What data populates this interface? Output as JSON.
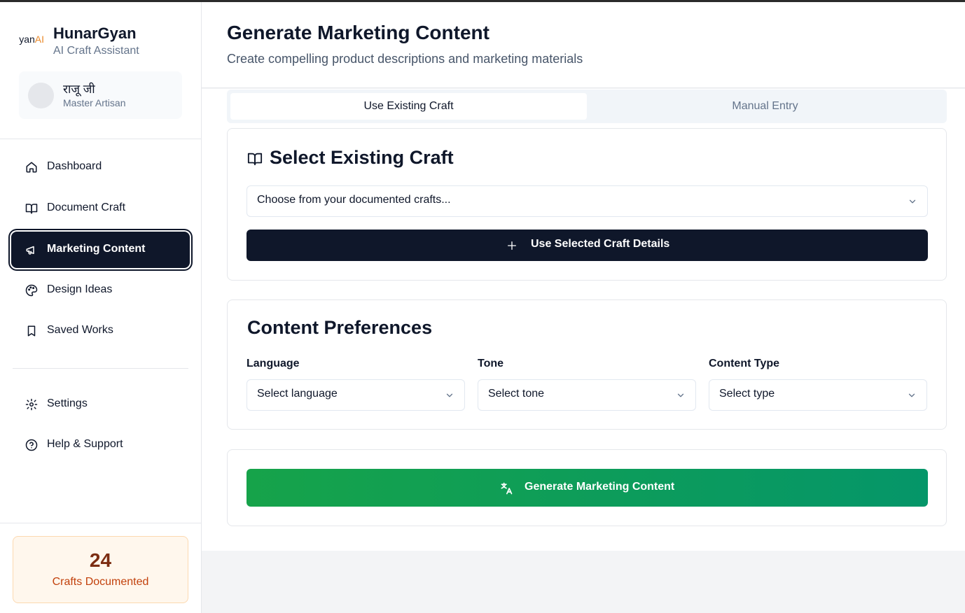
{
  "brand": {
    "logo_text": "yanAI",
    "logo_main": "yan",
    "logo_ai": "AI",
    "title": "HunarGyan",
    "subtitle": "AI Craft Assistant"
  },
  "user": {
    "name": "राजू जी",
    "role": "Master Artisan"
  },
  "nav": {
    "items": [
      {
        "label": "Dashboard",
        "icon": "home-icon",
        "active": false
      },
      {
        "label": "Document Craft",
        "icon": "book-open-icon",
        "active": false
      },
      {
        "label": "Marketing Content",
        "icon": "megaphone-icon",
        "active": true
      },
      {
        "label": "Design Ideas",
        "icon": "palette-icon",
        "active": false
      },
      {
        "label": "Saved Works",
        "icon": "bookmark-icon",
        "active": false
      }
    ],
    "secondary": [
      {
        "label": "Settings",
        "icon": "gear-icon"
      },
      {
        "label": "Help & Support",
        "icon": "help-circle-icon"
      }
    ]
  },
  "stats": {
    "count": "24",
    "label": "Crafts Documented"
  },
  "header": {
    "title": "Generate Marketing Content",
    "subtitle": "Create compelling product descriptions and marketing materials"
  },
  "tabs": [
    {
      "label": "Use Existing Craft",
      "active": true
    },
    {
      "label": "Manual Entry",
      "active": false
    }
  ],
  "existing_craft": {
    "title": "Select Existing Craft",
    "select_placeholder": "Choose from your documented crafts...",
    "button_label": "Use Selected Craft Details"
  },
  "preferences": {
    "title": "Content Preferences",
    "language": {
      "label": "Language",
      "placeholder": "Select language"
    },
    "tone": {
      "label": "Tone",
      "placeholder": "Select tone"
    },
    "content_type": {
      "label": "Content Type",
      "placeholder": "Select type"
    }
  },
  "generate": {
    "button_label": "Generate Marketing Content"
  },
  "colors": {
    "primary_dark": "#0f172a",
    "green_start": "#16a34a",
    "green_end": "#059669",
    "accent_orange": "#c2410c",
    "logo_ai": "#ea8a2b"
  }
}
